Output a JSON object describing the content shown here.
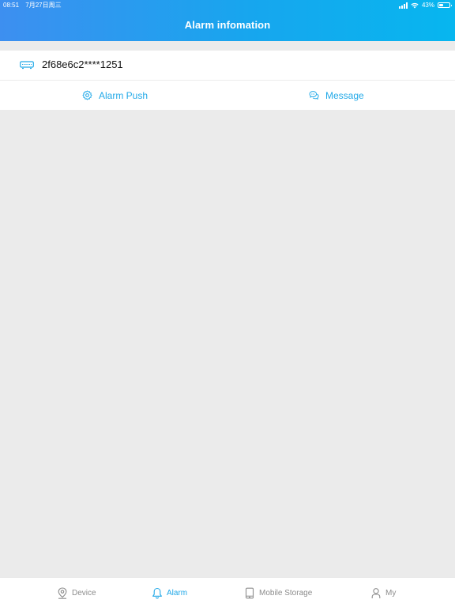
{
  "status_bar": {
    "time": "08:51",
    "date": "7月27日周三",
    "battery_text": "43%",
    "battery_level": 0.43
  },
  "header": {
    "title": "Alarm infomation"
  },
  "device": {
    "name": "2f68e6c2****1251",
    "icon": "nvr-device-icon"
  },
  "actions": {
    "alarm_push": {
      "label": "Alarm Push",
      "icon": "gear-icon"
    },
    "message": {
      "label": "Message",
      "icon": "chat-bubbles-icon"
    }
  },
  "tabbar": {
    "items": [
      {
        "label": "Device",
        "icon": "location-pin-icon",
        "active": false
      },
      {
        "label": "Alarm",
        "icon": "bell-icon",
        "active": true
      },
      {
        "label": "Mobile Storage",
        "icon": "tablet-icon",
        "active": false
      },
      {
        "label": "My",
        "icon": "person-icon",
        "active": false
      }
    ]
  },
  "colors": {
    "accent": "#21a8e7",
    "header_gradient_start": "#3d8ff0",
    "header_gradient_end": "#07b6ef",
    "background": "#ebebeb",
    "inactive": "#8c8c8c"
  }
}
